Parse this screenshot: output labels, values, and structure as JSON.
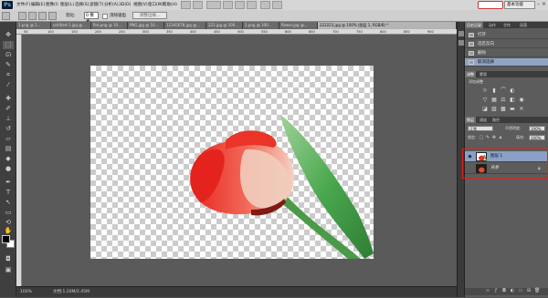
{
  "app": {
    "logo": "Ps"
  },
  "menu": [
    "文件(F)",
    "编辑(E)",
    "图像(I)",
    "图层(L)",
    "选择(S)",
    "滤镜(T)",
    "分析(A)",
    "3D(D)",
    "视图(V)",
    "窗口(W)",
    "帮助(H)"
  ],
  "workspace": {
    "label": "基本功能"
  },
  "options": {
    "feather_label": "羽化:",
    "feather_value": "0 像素",
    "antialias_label": "消除锯齿",
    "style_label": "样式:",
    "refine_label": "调整边缘..."
  },
  "tabs": [
    {
      "label": "1.png @ 1..."
    },
    {
      "label": "untitled-1.jpg @..."
    },
    {
      "label": "fire.png @ 10..."
    },
    {
      "label": "PNG.jpg @ 10..."
    },
    {
      "label": "12345678.jpg @..."
    },
    {
      "label": "222.jpg @ 100..."
    },
    {
      "label": "2.png @ 100..."
    },
    {
      "label": "flower.jpg @..."
    },
    {
      "label": "222223.jpg @ 100% (图层 1, RGB/8) *"
    }
  ],
  "ruler_ticks": [
    "50",
    "100",
    "150",
    "200",
    "250",
    "300",
    "350",
    "400",
    "450",
    "500",
    "550",
    "600",
    "650",
    "700",
    "750",
    "800",
    "850",
    "900"
  ],
  "status": {
    "zoom": "100%",
    "doc": "文档:1.20M/2.45M"
  },
  "history": {
    "tabs": [
      "历史记录",
      "动作",
      "字符",
      "段落"
    ],
    "items": [
      {
        "label": "打开",
        "selected": false
      },
      {
        "label": "选区反向",
        "selected": false
      },
      {
        "label": "删除",
        "selected": false
      },
      {
        "label": "取消选择",
        "selected": true
      }
    ]
  },
  "adjustments": {
    "tabs": [
      "调整",
      "蒙版"
    ],
    "title": "添加调整"
  },
  "layers": {
    "tabs": [
      "图层",
      "通道",
      "路径"
    ],
    "blend_mode": "正常",
    "opacity_label": "不透明度:",
    "opacity_value": "100%",
    "lock_label": "锁定:",
    "fill_label": "填充:",
    "fill_value": "100%",
    "items": [
      {
        "name": "图层 1",
        "selected": true,
        "visible": true
      },
      {
        "name": "背景",
        "selected": false,
        "visible": false,
        "locked": true
      }
    ]
  },
  "colors": {
    "highlight": "#e02020",
    "selection": "#8aa0c6"
  }
}
